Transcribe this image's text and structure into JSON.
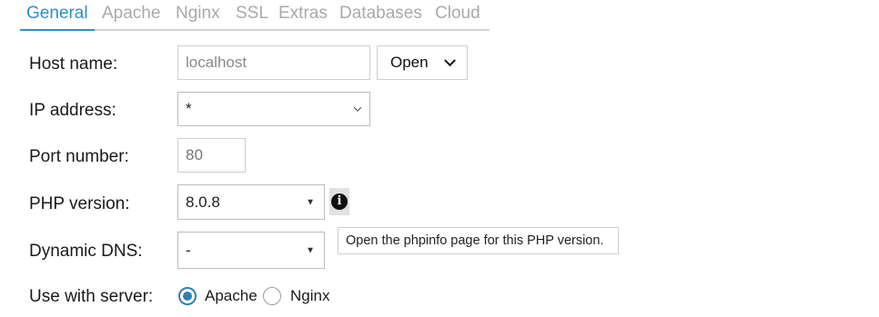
{
  "tabs": [
    {
      "label": "General",
      "active": true
    },
    {
      "label": "Apache"
    },
    {
      "label": "Nginx"
    },
    {
      "label": "SSL"
    },
    {
      "label": "Extras"
    },
    {
      "label": "Databases"
    },
    {
      "label": "Cloud"
    }
  ],
  "form": {
    "host_name": {
      "label": "Host name:",
      "value": "localhost",
      "open_button": "Open"
    },
    "ip_address": {
      "label": "IP address:",
      "value": "*"
    },
    "port_number": {
      "label": "Port number:",
      "placeholder": "80"
    },
    "php_version": {
      "label": "PHP version:",
      "value": "8.0.8",
      "info_icon": "info-icon"
    },
    "dynamic_dns": {
      "label": "Dynamic DNS:",
      "value": "-"
    },
    "use_with_server": {
      "label": "Use with server:",
      "options": [
        "Apache",
        "Nginx"
      ],
      "selected": "Apache"
    }
  },
  "tooltip": {
    "text": "Open the phpinfo page for this PHP version."
  },
  "colors": {
    "accent": "#2f8fc2",
    "tab_inactive": "#a9a9a9",
    "radio": "#2f7fb5"
  }
}
